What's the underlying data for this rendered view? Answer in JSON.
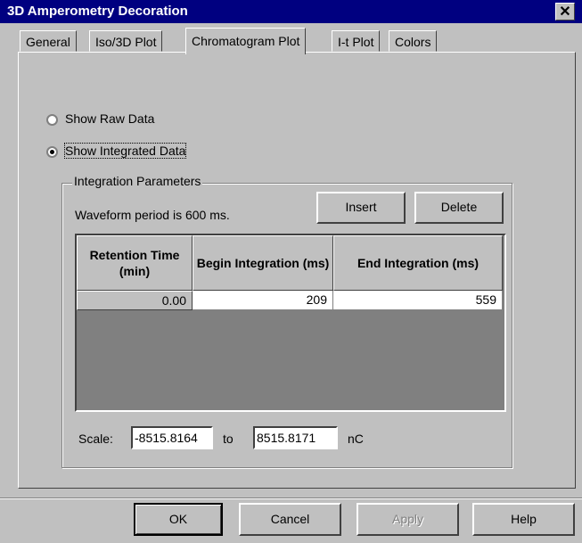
{
  "window": {
    "title": "3D Amperometry Decoration",
    "close_glyph": "✕"
  },
  "tabs": [
    {
      "label": "General"
    },
    {
      "label": "Iso/3D Plot"
    },
    {
      "label": "Chromatogram Plot"
    },
    {
      "label": "I-t Plot"
    },
    {
      "label": "Colors"
    }
  ],
  "active_tab": "Chromatogram Plot",
  "display_options": {
    "raw_label": "Show Raw Data",
    "integrated_label": "Show Integrated Data",
    "selected": "integrated"
  },
  "integration": {
    "group_label": "Integration Parameters",
    "waveform_text": "Waveform period is 600 ms.",
    "insert_label": "Insert",
    "delete_label": "Delete",
    "columns": [
      "Retention Time (min)",
      "Begin Integration (ms)",
      "End Integration (ms)"
    ],
    "rows": [
      {
        "retention": "0.00",
        "begin": "209",
        "end": "559"
      }
    ]
  },
  "scale": {
    "label": "Scale:",
    "min": "-8515.8164",
    "to_label": "to",
    "max": "8515.8171",
    "unit": "nC"
  },
  "buttons": {
    "ok": "OK",
    "cancel": "Cancel",
    "apply": "Apply",
    "help": "Help"
  }
}
